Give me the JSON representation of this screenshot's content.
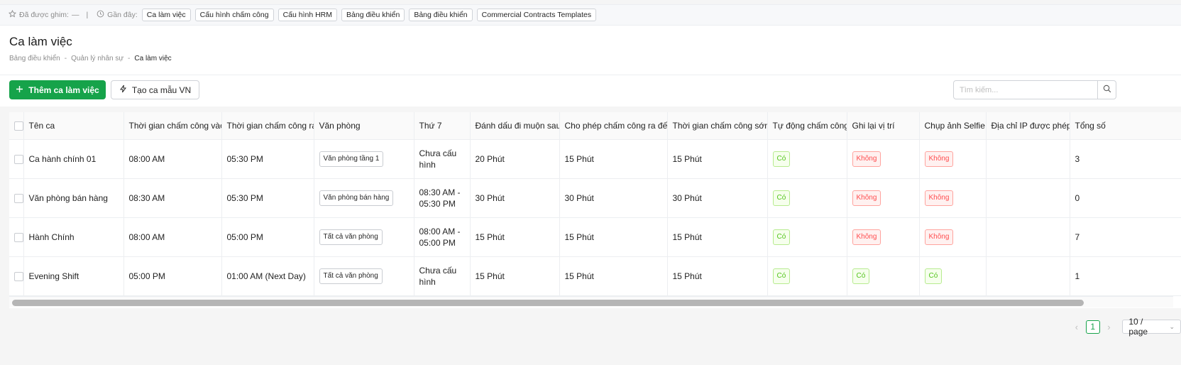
{
  "recent_bar": {
    "pinned_label": "Đã được ghim:",
    "pinned_value": "—",
    "recent_label": "Gần đây:",
    "recent_items": [
      "Ca làm việc",
      "Cấu hình chấm công",
      "Cấu hình HRM",
      "Bảng điều khiển",
      "Bảng điều khiển",
      "Commercial Contracts Templates"
    ]
  },
  "header": {
    "title": "Ca làm việc",
    "breadcrumb": [
      "Bảng điều khiển",
      "Quản lý nhân sự",
      "Ca làm việc"
    ]
  },
  "toolbar": {
    "add_label": "Thêm ca làm việc",
    "template_label": "Tạo ca mẫu VN",
    "search_placeholder": "Tìm kiếm..."
  },
  "table": {
    "columns": [
      "Tên ca",
      "Thời gian chấm công vào",
      "Thời gian chấm công ra",
      "Văn phòng",
      "Thứ 7",
      "Đánh dấu đi muộn sau",
      "Cho phép chấm công ra đến",
      "Thời gian chấm công sớm",
      "Tự động chấm công",
      "Ghi lại vị trí",
      "Chụp ảnh Selfie",
      "Địa chỉ IP được phép",
      "Tổng số"
    ],
    "rows": [
      {
        "name": "Ca hành chính 01",
        "check_in": "08:00 AM",
        "check_out": "05:30 PM",
        "office": "Văn phòng tầng 1",
        "saturday": "Chưa cấu hình",
        "late_after": "20 Phút",
        "checkout_until": "15 Phút",
        "early": "15 Phút",
        "auto": "Có",
        "location": "Không",
        "selfie": "Không",
        "ip": "",
        "total": "3"
      },
      {
        "name": "Văn phòng bán hàng",
        "check_in": "08:30 AM",
        "check_out": "05:30 PM",
        "office": "Văn phòng bán hàng",
        "saturday": "08:30 AM - 05:30 PM",
        "late_after": "30 Phút",
        "checkout_until": "30 Phút",
        "early": "30 Phút",
        "auto": "Có",
        "location": "Không",
        "selfie": "Không",
        "ip": "",
        "total": "0"
      },
      {
        "name": "Hành Chính",
        "check_in": "08:00 AM",
        "check_out": "05:00 PM",
        "office": "Tất cả văn phòng",
        "saturday": "08:00 AM - 05:00 PM",
        "late_after": "15 Phút",
        "checkout_until": "15 Phút",
        "early": "15 Phút",
        "auto": "Có",
        "location": "Không",
        "selfie": "Không",
        "ip": "",
        "total": "7"
      },
      {
        "name": "Evening Shift",
        "check_in": "05:00 PM",
        "check_out": "01:00 AM (Next Day)",
        "office": "Tất cả văn phòng",
        "saturday": "Chưa cấu hình",
        "late_after": "15 Phút",
        "checkout_until": "15 Phút",
        "early": "15 Phút",
        "auto": "Có",
        "location": "Có",
        "selfie": "Có",
        "ip": "",
        "total": "1"
      }
    ]
  },
  "pagination": {
    "current_page": "1",
    "page_size": "10 / page"
  },
  "colors": {
    "primary": "#16a34a",
    "yes": "#52c41a",
    "no": "#ff4d4f"
  }
}
